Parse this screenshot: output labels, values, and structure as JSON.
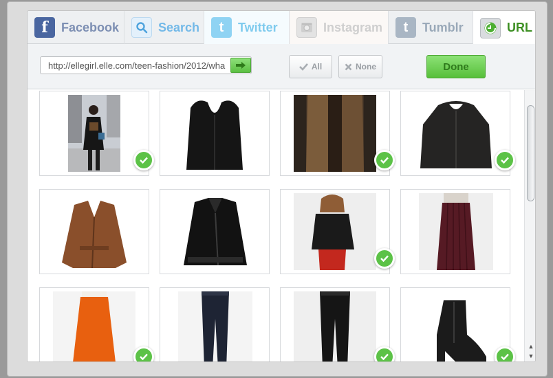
{
  "tabs": [
    {
      "label": "Facebook",
      "icon": "facebook-icon",
      "color": "#7d8fb3",
      "icon_bg": "#4a66a0",
      "active": false
    },
    {
      "label": "Search",
      "icon": "search-icon",
      "color": "#73b9e8",
      "icon_bg": "#e3f0fb",
      "active": false
    },
    {
      "label": "Twitter",
      "icon": "twitter-icon",
      "color": "#7fcbee",
      "icon_bg": "#8fd3f3",
      "active": false
    },
    {
      "label": "Instagram",
      "icon": "instagram-icon",
      "color": "#cfcfcf",
      "icon_bg": "#e8e8e8",
      "active": false
    },
    {
      "label": "Tumblr",
      "icon": "tumblr-icon",
      "color": "#9aa9b9",
      "icon_bg": "#a9b6c4",
      "active": false
    },
    {
      "label": "URL",
      "icon": "url-icon",
      "color": "#3d8f23",
      "icon_bg": "#d9dcdf",
      "active": true
    }
  ],
  "toolbar": {
    "url_value": "http://ellegirl.elle.com/teen-fashion/2012/wha",
    "select_all_label": "All",
    "select_none_label": "None",
    "done_label": "Done"
  },
  "colors": {
    "accent_green": "#5cc247",
    "tab_active_text": "#3d8f23"
  },
  "images": [
    {
      "name": "street-style-photo",
      "selected": true
    },
    {
      "name": "black-fur-vest",
      "selected": false
    },
    {
      "name": "brown-fur-vest",
      "selected": true
    },
    {
      "name": "black-fur-jacket",
      "selected": true
    },
    {
      "name": "brown-leather-jacket",
      "selected": false
    },
    {
      "name": "black-leather-jacket",
      "selected": false
    },
    {
      "name": "model-leather-jacket-red-pants",
      "selected": true
    },
    {
      "name": "burgundy-pleated-skirt",
      "selected": false
    },
    {
      "name": "orange-skirt",
      "selected": true
    },
    {
      "name": "dark-skinny-jeans",
      "selected": false
    },
    {
      "name": "black-coated-jeans",
      "selected": true
    },
    {
      "name": "black-suede-wedge-boot",
      "selected": true
    }
  ]
}
